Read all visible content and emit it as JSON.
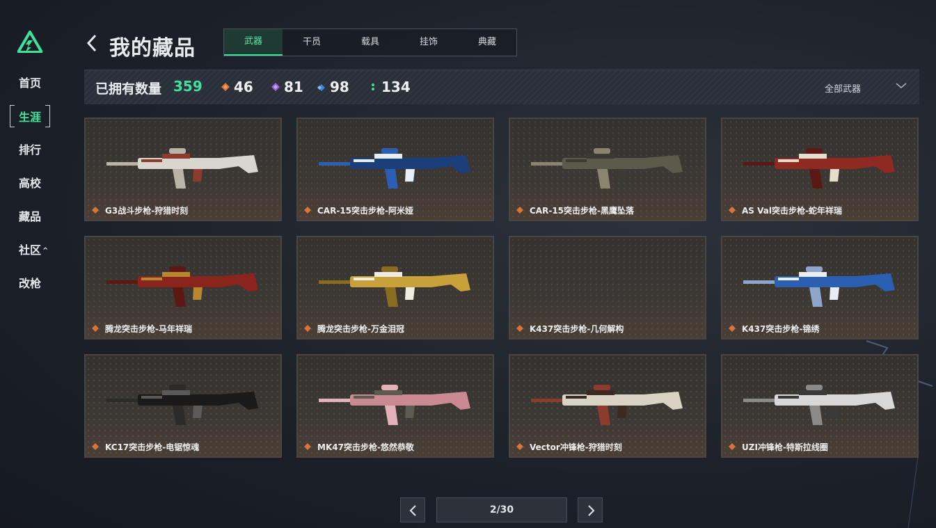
{
  "sidebar": {
    "items": [
      {
        "label": "首页"
      },
      {
        "label": "生涯"
      },
      {
        "label": "排行"
      },
      {
        "label": "高校"
      },
      {
        "label": "藏品"
      },
      {
        "label": "社区"
      },
      {
        "label": "改枪"
      }
    ]
  },
  "header": {
    "title": "我的藏品",
    "tabs": [
      {
        "label": "武器"
      },
      {
        "label": "干员"
      },
      {
        "label": "载具"
      },
      {
        "label": "挂饰"
      },
      {
        "label": "典藏"
      }
    ]
  },
  "stats": {
    "owned_label": "已拥有数量",
    "owned_count": "359",
    "counts": [
      {
        "value": "46",
        "color": "#d9743c",
        "icon": "orange-gem-icon"
      },
      {
        "value": "81",
        "color": "#9a63e6",
        "icon": "purple-gem-icon"
      },
      {
        "value": "98",
        "color": "#3f86e0",
        "icon": "blue-gem-icon"
      },
      {
        "value": "134",
        "color": "#3ee29b",
        "icon": "green-gem-icon"
      }
    ],
    "filter_label": "全部武器"
  },
  "cards": [
    {
      "name": "G3战斗步枪-狩猎时刻",
      "colors": [
        "#d9d6cf",
        "#8c3b2d",
        "#b9b3a8"
      ]
    },
    {
      "name": "CAR-15突击步枪-阿米娅",
      "colors": [
        "#1c3e7a",
        "#e8eef5",
        "#2a5fb3"
      ]
    },
    {
      "name": "CAR-15突击步枪-黑鹰坠落",
      "colors": [
        "#5d5a4c",
        "#3b3a33",
        "#8b8570"
      ]
    },
    {
      "name": "AS Val突击步枪-蛇年祥瑞",
      "colors": [
        "#8e2a22",
        "#e7ddcc",
        "#5a1914"
      ]
    },
    {
      "name": "腾龙突击步枪-马年祥瑞",
      "colors": [
        "#8a241c",
        "#b8872f",
        "#5c1813"
      ]
    },
    {
      "name": "腾龙突击步枪-万金泪冠",
      "colors": [
        "#c8a13a",
        "#f1ece2",
        "#8a6c20"
      ]
    },
    {
      "name": "K437突击步枪-几何解构",
      "colors": [],
      "empty": true
    },
    {
      "name": "K437突击步枪-锦绣",
      "colors": [
        "#2b5fb2",
        "#e9eef5",
        "#8ea6c9"
      ]
    },
    {
      "name": "KC17突击步枪-电锯惊魂",
      "colors": [
        "#1a1a1a",
        "#5a5a5a",
        "#2b2b2b"
      ]
    },
    {
      "name": "MK47突击步枪-悠然恭敬",
      "colors": [
        "#c98a92",
        "#5c5b4f",
        "#e2b2b8"
      ]
    },
    {
      "name": "Vector冲锋枪-狩猎时刻",
      "colors": [
        "#d9d3c3",
        "#3a2a22",
        "#8c3b2d"
      ]
    },
    {
      "name": "UZI冲锋枪-特斯拉线圈",
      "colors": [
        "#d8d8d8",
        "#3a3a3a",
        "#8a8a8a"
      ]
    }
  ],
  "rarity_color": "#d9743c",
  "accent_color": "#3ee29b",
  "pagination": {
    "indicator": "2/30"
  }
}
